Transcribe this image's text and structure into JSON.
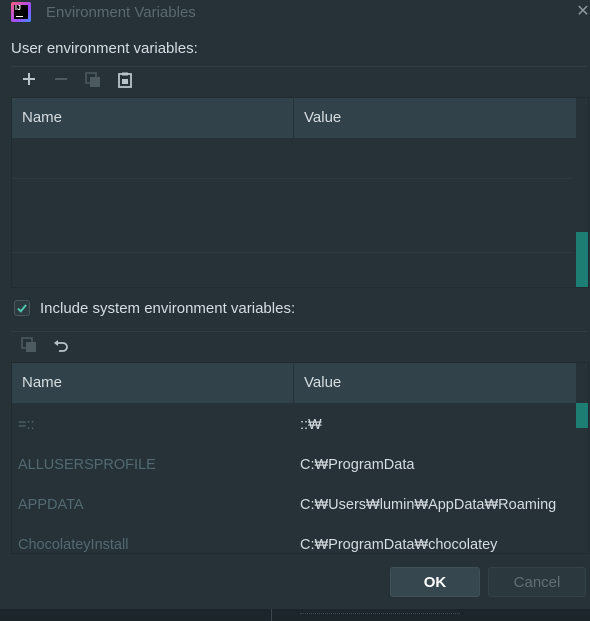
{
  "window": {
    "title": "Environment Variables",
    "app_icon_text": "IJ"
  },
  "user_section": {
    "label": "User environment variables:",
    "toolbar": [
      {
        "name": "add-icon",
        "glyph": "+",
        "enabled": true
      },
      {
        "name": "remove-icon",
        "glyph": "−",
        "enabled": false
      },
      {
        "name": "copy-icon",
        "glyph": "⧉",
        "enabled": false
      },
      {
        "name": "paste-icon",
        "glyph": "📋",
        "enabled": true
      }
    ],
    "columns": {
      "name": "Name",
      "value": "Value"
    },
    "rows": []
  },
  "system_section": {
    "checkbox_checked": true,
    "checkbox_label": "Include system environment variables:",
    "toolbar": [
      {
        "name": "copy-icon",
        "enabled": false
      },
      {
        "name": "undo-icon",
        "enabled": true
      }
    ],
    "columns": {
      "name": "Name",
      "value": "Value"
    },
    "rows": [
      {
        "name": "=::",
        "value": "::₩"
      },
      {
        "name": "ALLUSERSPROFILE",
        "value": "C:₩ProgramData"
      },
      {
        "name": "APPDATA",
        "value": "C:₩Users₩lumin₩AppData₩Roaming"
      },
      {
        "name": "ChocolateyInstall",
        "value": "C:₩ProgramData₩chocolatey"
      }
    ]
  },
  "buttons": {
    "ok": "OK",
    "cancel": "Cancel"
  },
  "colors": {
    "background": "#263238",
    "header": "#32424a",
    "scroll_accent": "#1d7f74",
    "muted_text": "#546871"
  }
}
